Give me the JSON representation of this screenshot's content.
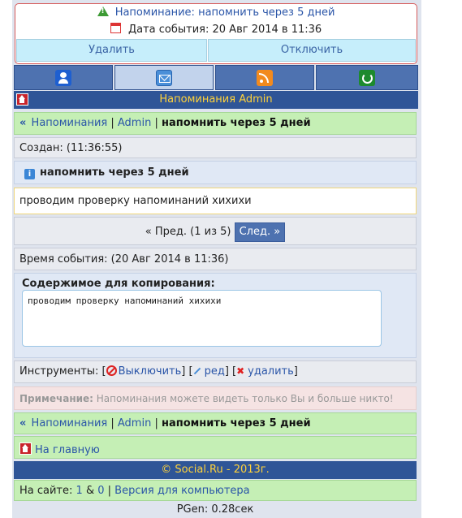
{
  "reminder": {
    "label": "Напоминание:",
    "text": "напомнить через 5 дней",
    "event_date_label": "Дата события:",
    "event_date": "20 Авг 2014 в 11:36",
    "delete_button": "Удалить",
    "disable_button": "Отключить"
  },
  "tabs": [
    {
      "icon": "user-icon"
    },
    {
      "icon": "mail-icon"
    },
    {
      "icon": "rss-icon"
    },
    {
      "icon": "refresh-icon"
    }
  ],
  "titlebar": {
    "title": "Напоминания Admin"
  },
  "breadcrumb": {
    "arrow": "«",
    "root": "Напоминания",
    "sep1": " | ",
    "user": "Admin",
    "sep2": " | ",
    "current": "напомнить через 5 дней"
  },
  "created": "Создан: (11:36:55)",
  "subject": "напомнить через 5 дней",
  "message": "проводим проверку напоминаний хихихи",
  "pager": {
    "prev": "« Пред.",
    "status": "(1 из 5)",
    "next": "След. »"
  },
  "event_time": "Время события: (20 Авг 2014 в 11:36)",
  "copy": {
    "label": "Содержимое для копирования:",
    "text": "проводим проверку напоминаний хихихи"
  },
  "tools": {
    "label": "Инструменты: [",
    "disable": "Выключить",
    "b1": "] [",
    "edit": "ред",
    "b2": "] [",
    "delete": "удалить",
    "b3": "]"
  },
  "note": {
    "bold": "Примечание:",
    "text": " Напоминания можете видеть только Вы и больше никто!"
  },
  "home_link": "На главную",
  "footer": {
    "copyright": "© Social.Ru - 2013г."
  },
  "online": {
    "label": "На сайте:",
    "count1": "1",
    "amp": " & ",
    "count2": "0",
    "sep": " | ",
    "desktop": "Версия для компьютера"
  },
  "pgen": "PGen: 0.28сек"
}
